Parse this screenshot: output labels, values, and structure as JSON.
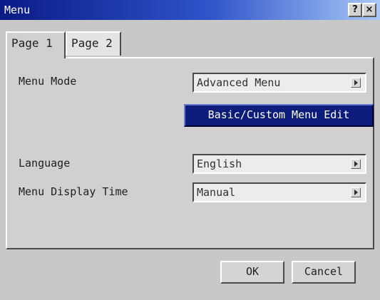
{
  "window": {
    "title": "Menu",
    "help_label": "?",
    "close_label": "×"
  },
  "tabs": [
    {
      "label": "Page 1",
      "selected": true
    },
    {
      "label": "Page 2",
      "selected": false
    }
  ],
  "settings": {
    "menu_mode": {
      "label": "Menu Mode",
      "value": "Advanced Menu"
    },
    "custom_edit_button": "Basic/Custom Menu Edit",
    "language": {
      "label": "Language",
      "value": "English"
    },
    "menu_display_time": {
      "label": "Menu Display Time",
      "value": "Manual"
    }
  },
  "footer": {
    "ok_label": "OK",
    "cancel_label": "Cancel"
  },
  "colors": {
    "title_gradient_start": "#0a1a86",
    "title_gradient_end": "#a8c8f6",
    "highlight_button": "#0c1c7a",
    "dialog_background": "#c8c8c8"
  }
}
